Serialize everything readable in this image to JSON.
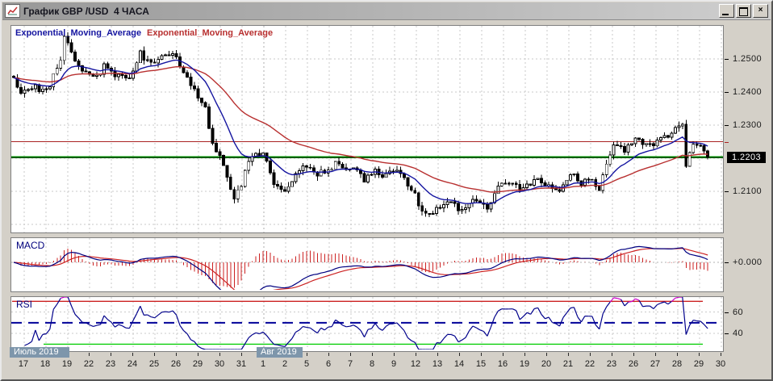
{
  "window": {
    "title": "График GBP /USD  4 ЧАСА",
    "controls": {
      "minimize": "_",
      "maximize": "❐",
      "close": "×"
    }
  },
  "colors": {
    "chrome": "#d4d0c8",
    "pane_bg": "#ffffff",
    "pane_border": "#7f7f7f",
    "grid": "#c9c9c9",
    "month_grid": "#adadad",
    "candle_outline": "#000000",
    "candle_bull_fill": "#ffffff",
    "candle_bear_fill": "#000000",
    "ema_fast": "#1515a0",
    "ema_slow": "#b83030",
    "hline_red": "#aa2222",
    "hline_green": "#00bb00",
    "bid_line": "#000000",
    "price_badge_bg": "#000000",
    "price_badge_text": "#ffffff",
    "macd_line": "#000080",
    "signal_line": "#cc2222",
    "histogram": "#cc2222",
    "zero_line": "#b0b0b0",
    "rsi_line": "#00008b",
    "rsi_upper": "#cc2222",
    "rsi_mid": "#000099",
    "rsi_lower": "#00cc00",
    "rsi_overbought": "#cc00cc",
    "month_badge_bg": "#7e96ab",
    "month_badge_text": "#ffffff",
    "axis_text": "#1a1a1a"
  },
  "chart_data": {
    "type": "candlestick",
    "title": "GBP/USD 4-hour chart with EMA overlays, MACD and RSI",
    "symbol": "GBP /USD",
    "timeframe": "4 ЧАСА",
    "legend": [
      {
        "label": "Exponential_Moving_Average",
        "color": "#1515a0"
      },
      {
        "label": "Exponential_Moving_Average",
        "color": "#b83030"
      }
    ],
    "ylim": [
      1.1976,
      1.26
    ],
    "y_ticks": [
      {
        "label": "1.2500",
        "value": 1.25
      },
      {
        "label": "1.2400",
        "value": 1.24
      },
      {
        "label": "1.2300",
        "value": 1.23
      },
      {
        "label": "1.2100",
        "value": 1.21
      }
    ],
    "current_price": {
      "label": "1.2203",
      "value": 1.2203
    },
    "hlines": [
      {
        "value": 1.225,
        "color": "#aa2222",
        "width": 1
      },
      {
        "value": 1.2203,
        "color": "#00bb00",
        "width": 2.5
      },
      {
        "value": 1.2203,
        "color": "#000000",
        "width": 1
      }
    ],
    "candles": {
      "count": 193,
      "per_day": 6,
      "noise": {
        "body": 0.0011,
        "wick": 0.0014,
        "seed": 11
      },
      "anchors": [
        [
          0,
          1.244
        ],
        [
          2,
          1.24
        ],
        [
          6,
          1.2415
        ],
        [
          9,
          1.2405
        ],
        [
          13,
          1.249
        ],
        [
          14,
          1.2565
        ],
        [
          17,
          1.25
        ],
        [
          19,
          1.2465
        ],
        [
          22,
          1.244
        ],
        [
          25,
          1.2475
        ],
        [
          28,
          1.2455
        ],
        [
          32,
          1.244
        ],
        [
          35,
          1.252
        ],
        [
          37,
          1.249
        ],
        [
          41,
          1.2505
        ],
        [
          44,
          1.2525
        ],
        [
          47,
          1.2455
        ],
        [
          50,
          1.2405
        ],
        [
          53,
          1.2355
        ],
        [
          55,
          1.2245
        ],
        [
          58,
          1.2185
        ],
        [
          61,
          1.2075
        ],
        [
          63,
          1.2125
        ],
        [
          66,
          1.221
        ],
        [
          69,
          1.222
        ],
        [
          72,
          1.2125
        ],
        [
          75,
          1.21
        ],
        [
          78,
          1.216
        ],
        [
          80,
          1.2175
        ],
        [
          83,
          1.216
        ],
        [
          86,
          1.215
        ],
        [
          89,
          1.2185
        ],
        [
          92,
          1.216
        ],
        [
          95,
          1.2175
        ],
        [
          97,
          1.2135
        ],
        [
          100,
          1.216
        ],
        [
          103,
          1.215
        ],
        [
          106,
          1.2175
        ],
        [
          109,
          1.2125
        ],
        [
          112,
          1.2065
        ],
        [
          114,
          1.2025
        ],
        [
          117,
          1.205
        ],
        [
          120,
          1.2075
        ],
        [
          123,
          1.205
        ],
        [
          126,
          1.2065
        ],
        [
          128,
          1.2075
        ],
        [
          131,
          1.204
        ],
        [
          134,
          1.211
        ],
        [
          137,
          1.2125
        ],
        [
          140,
          1.211
        ],
        [
          142,
          1.2125
        ],
        [
          145,
          1.2135
        ],
        [
          148,
          1.211
        ],
        [
          151,
          1.21
        ],
        [
          154,
          1.215
        ],
        [
          157,
          1.2125
        ],
        [
          159,
          1.2135
        ],
        [
          162,
          1.211
        ],
        [
          164,
          1.2175
        ],
        [
          166,
          1.2245
        ],
        [
          169,
          1.222
        ],
        [
          172,
          1.226
        ],
        [
          175,
          1.2235
        ],
        [
          177,
          1.2245
        ],
        [
          180,
          1.226
        ],
        [
          183,
          1.2285
        ],
        [
          185,
          1.2295
        ],
        [
          186,
          1.218
        ],
        [
          188,
          1.225
        ],
        [
          190,
          1.223
        ],
        [
          192,
          1.2203
        ]
      ]
    },
    "ema_periods": {
      "fast": 14,
      "slow": 42
    },
    "macd": {
      "label": "MACD",
      "axis_label": "+0.000",
      "params": {
        "fast": 12,
        "slow": 26,
        "signal": 9
      }
    },
    "rsi": {
      "label": "RSI",
      "period": 14,
      "ylim": [
        25,
        74
      ],
      "levels": [
        {
          "value": 70,
          "style": "solid",
          "color": "#cc2222"
        },
        {
          "value": 50,
          "style": "dashed",
          "color": "#000099"
        },
        {
          "value": 30,
          "style": "solid",
          "color": "#00cc00"
        }
      ],
      "axis_ticks": [
        {
          "label": "60",
          "value": 60
        },
        {
          "label": "40",
          "value": 40
        }
      ]
    },
    "x_axis": {
      "start_x": 27,
      "step": 27,
      "day_labels": [
        "17",
        "18",
        "19",
        "22",
        "23",
        "24",
        "25",
        "26",
        "29",
        "30",
        "31",
        "1",
        "2",
        "5",
        "6",
        "7",
        "8",
        "9",
        "12",
        "13",
        "14",
        "15",
        "16",
        "19",
        "20",
        "21",
        "22",
        "23",
        "26",
        "27",
        "28",
        "29",
        "30"
      ],
      "month_labels": [
        {
          "label": "Июль 2019",
          "x": 10,
          "width": 74
        },
        {
          "label": "Авг 2019",
          "x": 316,
          "width": 57
        }
      ]
    }
  }
}
